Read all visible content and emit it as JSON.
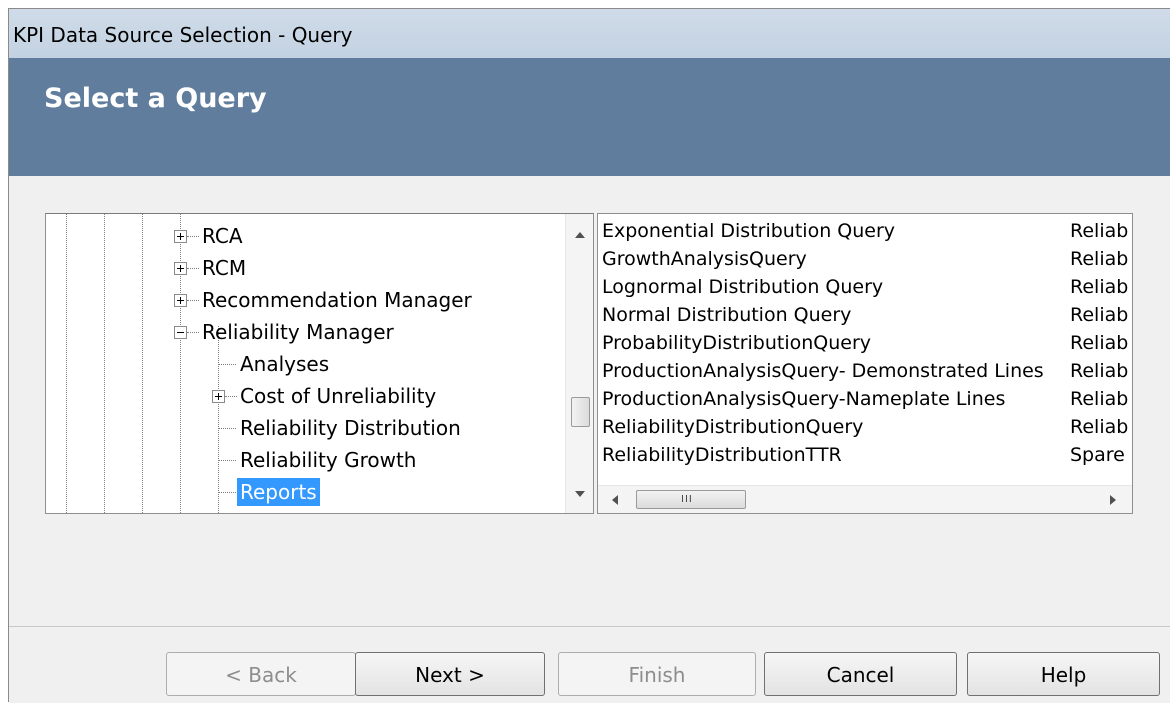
{
  "window": {
    "title": "KPI Data Source Selection - Query"
  },
  "header": {
    "title": "Select a Query"
  },
  "tree": {
    "items": [
      {
        "label": "RCA",
        "expander": "plus"
      },
      {
        "label": "RCM",
        "expander": "plus"
      },
      {
        "label": "Recommendation Manager",
        "expander": "plus"
      },
      {
        "label": "Reliability Manager",
        "expander": "minus"
      },
      {
        "label": "Analyses",
        "expander": "none"
      },
      {
        "label": "Cost of Unreliability",
        "expander": "plus"
      },
      {
        "label": "Reliability Distribution",
        "expander": "none"
      },
      {
        "label": "Reliability Growth",
        "expander": "none"
      },
      {
        "label": "Reports",
        "expander": "none",
        "selected": true
      }
    ]
  },
  "list": {
    "rows": [
      {
        "name": "Exponential Distribution Query",
        "family": "Reliab"
      },
      {
        "name": "GrowthAnalysisQuery",
        "family": "Reliab"
      },
      {
        "name": "Lognormal Distribution Query",
        "family": "Reliab"
      },
      {
        "name": "Normal Distribution Query",
        "family": "Reliab"
      },
      {
        "name": "ProbabilityDistributionQuery",
        "family": "Reliab"
      },
      {
        "name": "ProductionAnalysisQuery- Demonstrated Lines",
        "family": "Reliab"
      },
      {
        "name": "ProductionAnalysisQuery-Nameplate Lines",
        "family": "Reliab"
      },
      {
        "name": "ReliabilityDistributionQuery",
        "family": "Reliab"
      },
      {
        "name": "ReliabilityDistributionTTR",
        "family": "Spare"
      }
    ],
    "scroll_grip": "III"
  },
  "buttons": {
    "back": "< Back",
    "next": "Next >",
    "finish": "Finish",
    "cancel": "Cancel",
    "help": "Help"
  },
  "colors": {
    "header_bg": "#607d9d",
    "selection": "#3399ff"
  }
}
